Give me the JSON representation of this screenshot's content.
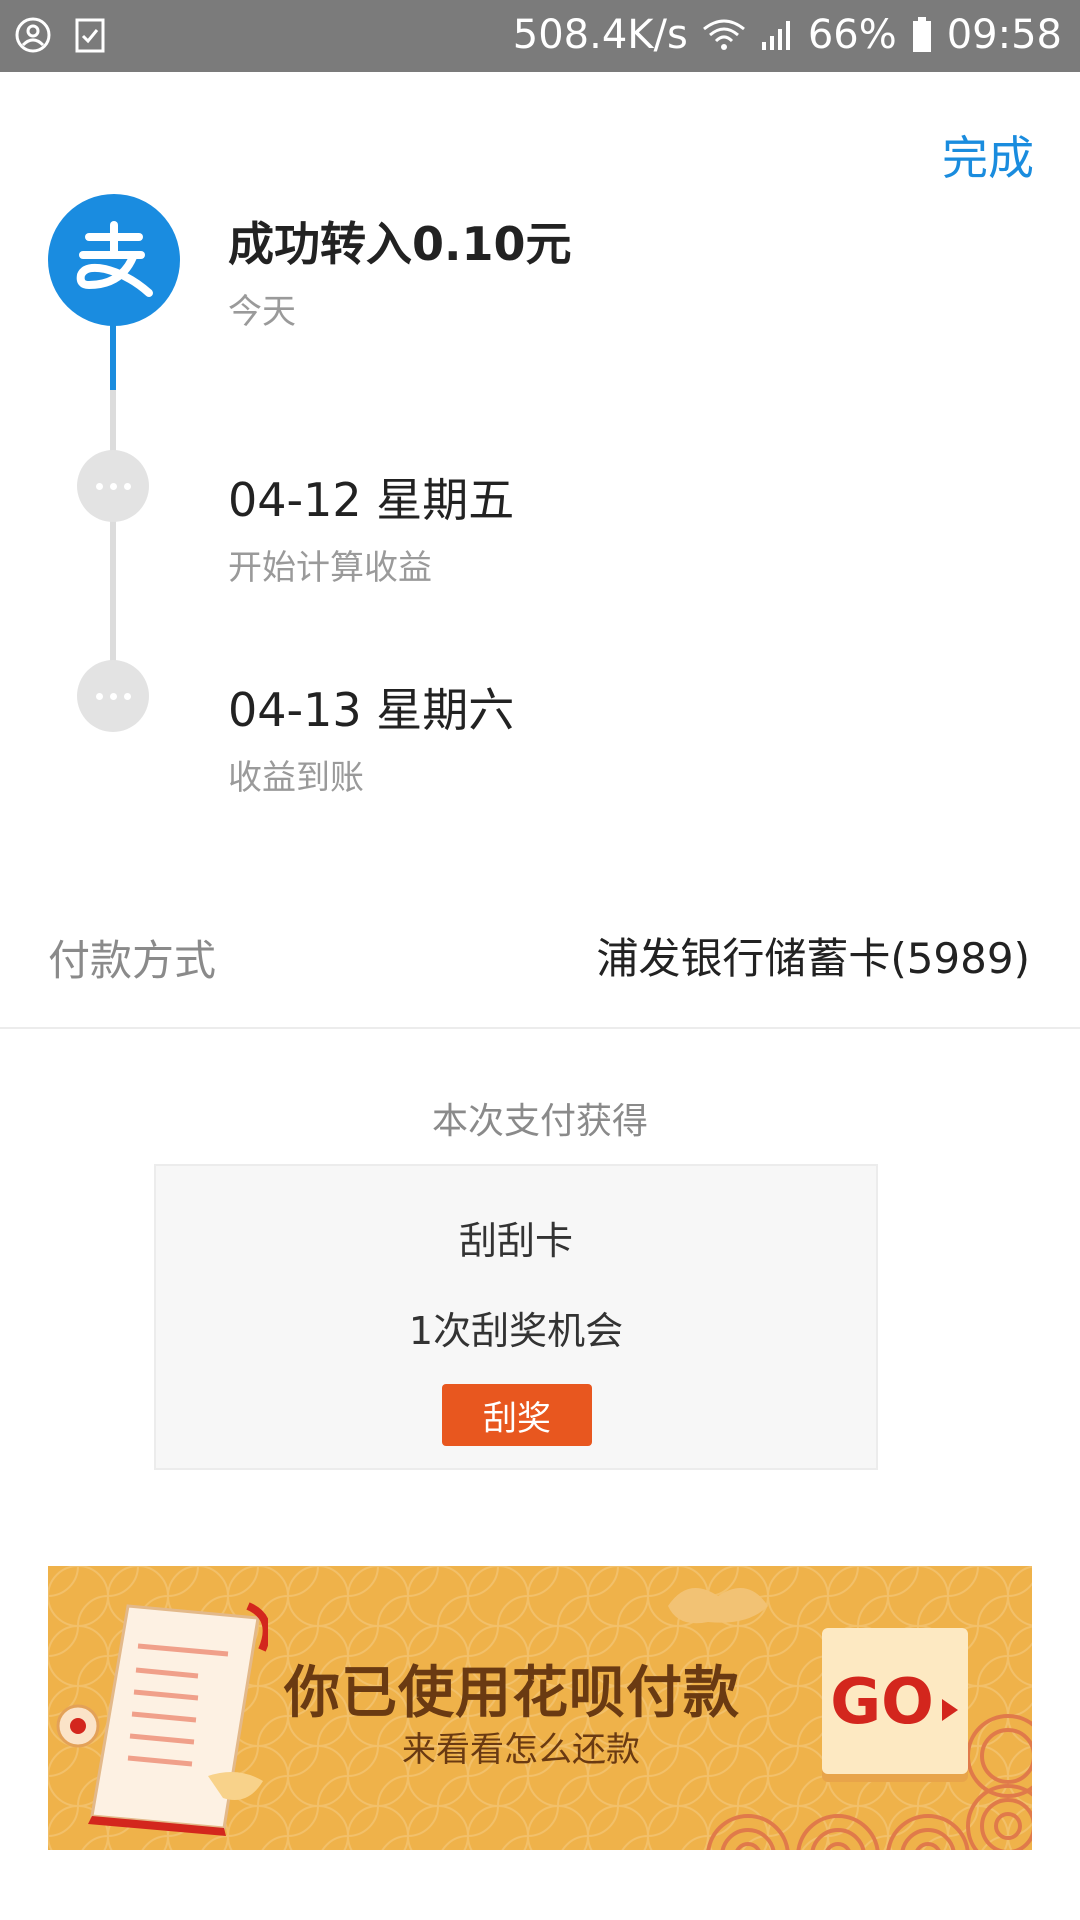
{
  "status_bar": {
    "network_speed": "508.4K/s",
    "battery": "66%",
    "time": "09:58"
  },
  "header": {
    "done_label": "完成"
  },
  "timeline": [
    {
      "title": "成功转入0.10元",
      "subtitle": "今天"
    },
    {
      "title": "04-12 星期五",
      "subtitle": "开始计算收益"
    },
    {
      "title": "04-13 星期六",
      "subtitle": "收益到账"
    }
  ],
  "payment": {
    "label": "付款方式",
    "value": "浦发银行储蓄卡(5989)"
  },
  "reward": {
    "heading": "本次支付获得",
    "card_title": "刮刮卡",
    "card_desc": "1次刮奖机会",
    "button_label": "刮奖"
  },
  "banner": {
    "title": "你已使用花呗付款",
    "subtitle": "来看看怎么还款",
    "go_label": "GO"
  },
  "colors": {
    "accent": "#1a8cde",
    "button": "#e8571f",
    "banner": "#efb24a"
  }
}
